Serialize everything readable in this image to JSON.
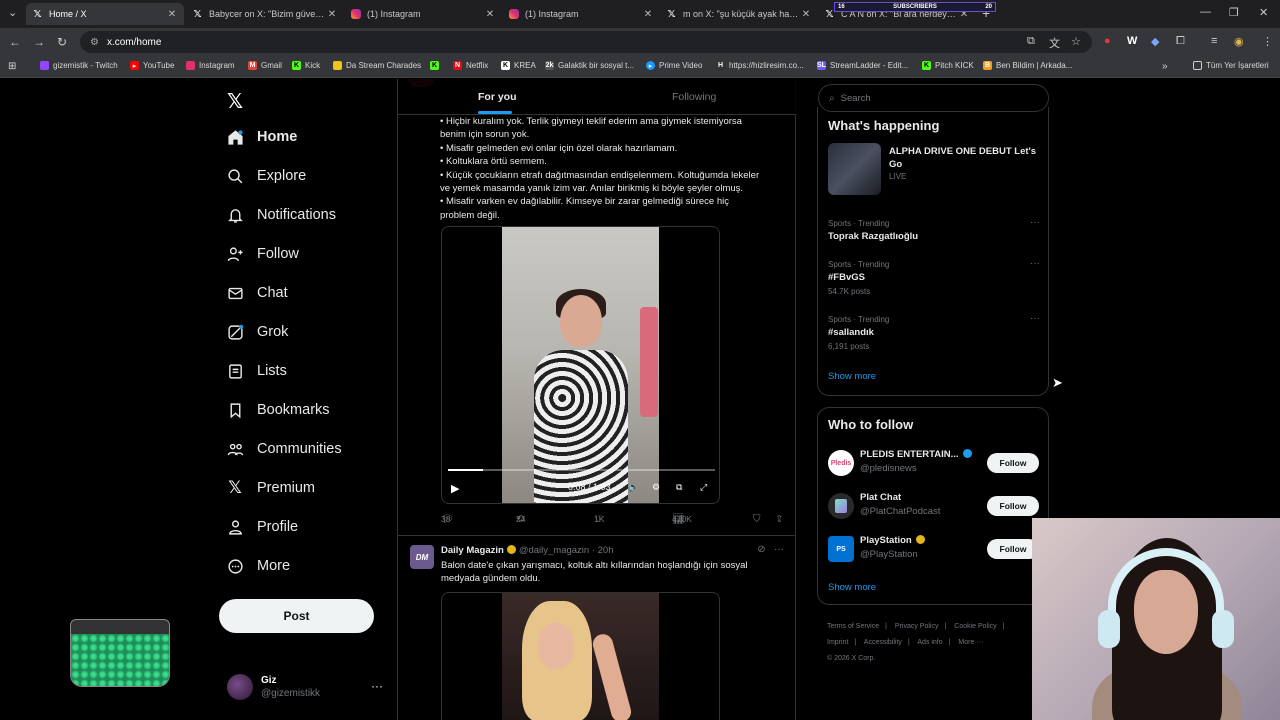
{
  "browser": {
    "tabs": [
      {
        "label": "Home / X",
        "icon": "x-logo-icon",
        "active": true
      },
      {
        "label": "Babycer on X: \"Bizim güven yeri",
        "icon": "x-logo-icon",
        "active": false
      },
      {
        "label": "(1) Instagram",
        "icon": "instagram-icon",
        "active": false
      },
      {
        "label": "(1) Instagram",
        "icon": "instagram-icon",
        "active": false
      },
      {
        "label": "m on X: \"şu küçük ayak hareket",
        "icon": "x-logo-icon",
        "active": false
      },
      {
        "label": "C A N on X: \"Bi ara nerdeyse tü",
        "icon": "x-logo-icon",
        "active": false
      }
    ],
    "overlay": {
      "left": "16",
      "label": "SUBSCRIBERS",
      "right": "20"
    },
    "url": "x.com/home",
    "bookmarks": [
      {
        "label": "gizemistik - Twitch",
        "color": "#9146ff"
      },
      {
        "label": "YouTube",
        "color": "#ff0000"
      },
      {
        "label": "Instagram",
        "color": "#e1306c"
      },
      {
        "label": "Gmail",
        "color": "#ea4335"
      },
      {
        "label": "Kick",
        "color": "#53fc18"
      },
      {
        "label": "Da Stream Charades",
        "color": "#f0c419"
      },
      {
        "label": "",
        "color": "#53fc18"
      },
      {
        "label": "Netflix",
        "color": "#e50914"
      },
      {
        "label": "KREA",
        "color": "#ffffff"
      },
      {
        "label": "Galaktik bir sosyal t...",
        "color": "#888888"
      },
      {
        "label": "Prime Video",
        "color": "#1a98ff"
      },
      {
        "label": "https://hizliresim.co...",
        "color": "#cccccc"
      },
      {
        "label": "StreamLadder - Edit...",
        "color": "#6e5cf0"
      },
      {
        "label": "Pitch KICK",
        "color": "#53fc18"
      },
      {
        "label": "Ben Bildim | Arkada...",
        "color": "#f29d1e"
      }
    ],
    "all_bookmarks": "Tüm Yer İşaretleri"
  },
  "nav": {
    "items": [
      {
        "label": "Home",
        "icon": "home-icon"
      },
      {
        "label": "Explore",
        "icon": "search-icon"
      },
      {
        "label": "Notifications",
        "icon": "bell-icon"
      },
      {
        "label": "Follow",
        "icon": "follow-icon"
      },
      {
        "label": "Chat",
        "icon": "mail-icon"
      },
      {
        "label": "Grok",
        "icon": "grok-icon"
      },
      {
        "label": "Lists",
        "icon": "list-icon"
      },
      {
        "label": "Bookmarks",
        "icon": "bookmark-icon"
      },
      {
        "label": "Communities",
        "icon": "communities-icon"
      },
      {
        "label": "Premium",
        "icon": "x-logo-icon"
      },
      {
        "label": "Profile",
        "icon": "profile-icon"
      },
      {
        "label": "More",
        "icon": "more-icon"
      }
    ],
    "post_label": "Post",
    "account": {
      "name": "Giz",
      "handle": "@gizemistikk"
    }
  },
  "timeline": {
    "tabs": {
      "for_you": "For you",
      "following": "Following"
    },
    "post1": {
      "lines": [
        "• Hiçbir kuralım yok. Terlik giymeyi teklif ederim ama giymek istemiyorsa",
        "benim için sorun yok.",
        "• Misafir gelmeden evi onlar için özel olarak hazırlamam.",
        "• Koltuklara örtü sermem.",
        "• Küçük çocukların etrafı dağıtmasından endişelenmem. Koltuğumda lekeler",
        "ve yemek masamda yanık izim var. Anılar birikmiş ki böyle şeyler olmuş.",
        "• Misafir varken ev dağılabilir. Kimseye bir zarar gelmediği sürece hiç",
        "problem değil."
      ],
      "video_time": "0:08 / 1:03",
      "video_progress": 0.13,
      "replies": "38",
      "reposts": "24",
      "likes": "1K",
      "views": "410K"
    },
    "post2": {
      "avatar_text": "DM",
      "name": "Daily Magazin",
      "handle": "@daily_magazin",
      "time": "· 20h",
      "text_lines": [
        "Balon date'e çıkan yarışmacı, koltuk altı kıllarından hoşlandığı için sosyal",
        "medyada gündem oldu."
      ]
    }
  },
  "sidebar": {
    "search_placeholder": "Search",
    "happening": {
      "title": "What's happening",
      "event": {
        "title": "ALPHA DRIVE ONE DEBUT Let's Go",
        "status": "LIVE"
      },
      "trends": [
        {
          "context": "Sports · Trending",
          "name": "Toprak Razgatlıoğlu",
          "posts": ""
        },
        {
          "context": "Sports · Trending",
          "name": "#FBvGS",
          "posts": "54.7K posts"
        },
        {
          "context": "Sports · Trending",
          "name": "#sallandık",
          "posts": "6,191 posts"
        }
      ],
      "show_more": "Show more"
    },
    "who_to_follow": {
      "title": "Who to follow",
      "accounts": [
        {
          "name": "PLEDIS ENTERTAIN...",
          "handle": "@pledisnews",
          "badge_color": "#1d9bf0",
          "avatar_text": "Pledis",
          "avatar_color": "#ffffff"
        },
        {
          "name": "Plat Chat",
          "handle": "@PlatChatPodcast",
          "badge_color": "",
          "avatar_text": "",
          "avatar_color": "#2a2a2a"
        },
        {
          "name": "PlayStation",
          "handle": "@PlayStation",
          "badge_color": "#e2b719",
          "avatar_text": "PS",
          "avatar_color": "#0070d1"
        }
      ],
      "follow_label": "Follow",
      "show_more": "Show more"
    },
    "footer": [
      "Terms of Service",
      "|",
      "Privacy Policy",
      "|",
      "Cookie Policy",
      "|",
      "Imprint",
      "|",
      "Accessibility",
      "|",
      "Ads info",
      "|",
      "More ···",
      "© 2026 X Corp."
    ]
  }
}
